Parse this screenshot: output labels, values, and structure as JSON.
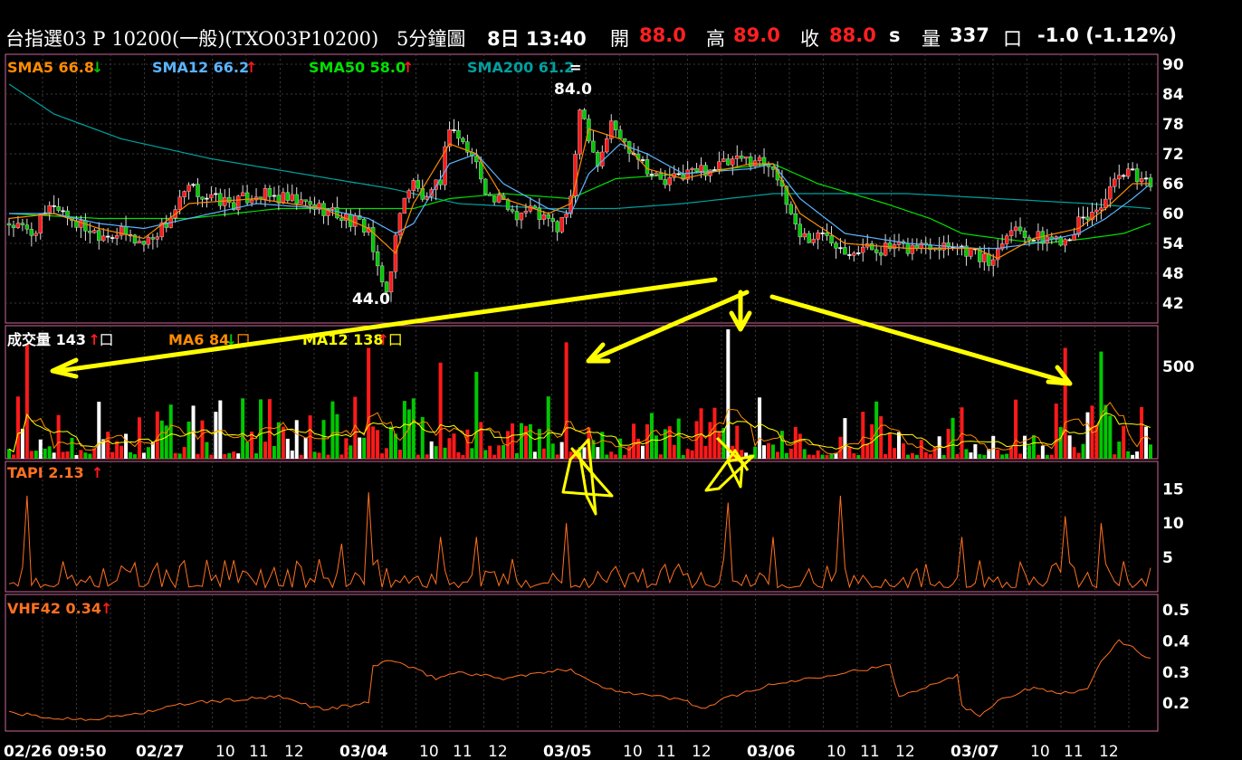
{
  "header": {
    "symbol": "台指選03 P 10200(一般)(TXO03P10200)",
    "period": "5分鐘圖",
    "datetime": "8日 13:40",
    "open_label": "開",
    "open": "88.0",
    "high_label": "高",
    "high": "89.0",
    "close_label": "收",
    "close": "88.0",
    "close_flag": "s",
    "volume_label": "量",
    "volume": "337",
    "volume_unit": "口",
    "change": "-1.0 (-1.12%)"
  },
  "colors": {
    "up": "#ff1a1a",
    "down": "#00c800",
    "flat": "#ffffff",
    "sma5": "#ff8c00",
    "sma12": "#5ab4ff",
    "sma50": "#00e000",
    "sma200": "#00a0a0",
    "grid": "#3a3a3a",
    "frame": "#cc6699",
    "annotation": "#ffff00",
    "indicator": "#ff7020"
  },
  "icons": {
    "up": "arrow-up-icon",
    "down": "arrow-down-icon",
    "flat": "equal-icon"
  },
  "chart_data": [
    {
      "type": "candlestick",
      "title": "",
      "series": [
        {
          "name": "SMA5",
          "value": "66.8",
          "dir": "down"
        },
        {
          "name": "SMA12",
          "value": "66.2",
          "dir": "up"
        },
        {
          "name": "SMA50",
          "value": "58.0",
          "dir": "up"
        },
        {
          "name": "SMA200",
          "value": "61.2",
          "dir": "flat"
        }
      ],
      "y_ticks": [
        "90",
        "84",
        "78",
        "72",
        "66",
        "60",
        "54",
        "48",
        "42"
      ],
      "ylim": [
        38,
        92
      ],
      "annotations": {
        "max": "84.0",
        "min": "44.0"
      },
      "price_path": [
        [
          0,
          58
        ],
        [
          5,
          56
        ],
        [
          10,
          62
        ],
        [
          15,
          58
        ],
        [
          20,
          56
        ],
        [
          25,
          56
        ],
        [
          30,
          54
        ],
        [
          35,
          58
        ],
        [
          40,
          65
        ],
        [
          45,
          63
        ],
        [
          50,
          62
        ],
        [
          55,
          64
        ],
        [
          60,
          63
        ],
        [
          65,
          62
        ],
        [
          70,
          61
        ],
        [
          75,
          59
        ],
        [
          80,
          57
        ],
        [
          82,
          48
        ],
        [
          84,
          44
        ],
        [
          86,
          55
        ],
        [
          88,
          64
        ],
        [
          90,
          66
        ],
        [
          93,
          62
        ],
        [
          96,
          67
        ],
        [
          98,
          78
        ],
        [
          101,
          74
        ],
        [
          104,
          70
        ],
        [
          107,
          63
        ],
        [
          110,
          62
        ],
        [
          113,
          60
        ],
        [
          116,
          61
        ],
        [
          119,
          59
        ],
        [
          122,
          57
        ],
        [
          125,
          62
        ],
        [
          127,
          82
        ],
        [
          129,
          76
        ],
        [
          131,
          70
        ],
        [
          134,
          78
        ],
        [
          137,
          74
        ],
        [
          140,
          72
        ],
        [
          143,
          68
        ],
        [
          146,
          66
        ],
        [
          150,
          68
        ],
        [
          155,
          69
        ],
        [
          160,
          70
        ],
        [
          165,
          71
        ],
        [
          170,
          70
        ],
        [
          172,
          64
        ],
        [
          174,
          60
        ],
        [
          176,
          56
        ],
        [
          178,
          55
        ],
        [
          182,
          56
        ],
        [
          186,
          53
        ],
        [
          190,
          53
        ],
        [
          195,
          53
        ],
        [
          200,
          53
        ],
        [
          205,
          54
        ],
        [
          210,
          54
        ],
        [
          215,
          52
        ],
        [
          218,
          50
        ],
        [
          220,
          53
        ],
        [
          222,
          57
        ],
        [
          225,
          57
        ],
        [
          228,
          55
        ],
        [
          232,
          55
        ],
        [
          235,
          55
        ],
        [
          238,
          58
        ],
        [
          241,
          60
        ],
        [
          244,
          63
        ],
        [
          247,
          67
        ],
        [
          250,
          68
        ],
        [
          254,
          66
        ]
      ],
      "sma5_path": [
        [
          0,
          59
        ],
        [
          10,
          60
        ],
        [
          20,
          57
        ],
        [
          30,
          55
        ],
        [
          40,
          62
        ],
        [
          55,
          63
        ],
        [
          70,
          61
        ],
        [
          80,
          57
        ],
        [
          86,
          52
        ],
        [
          90,
          62
        ],
        [
          98,
          74
        ],
        [
          104,
          72
        ],
        [
          110,
          63
        ],
        [
          120,
          60
        ],
        [
          125,
          62
        ],
        [
          129,
          77
        ],
        [
          136,
          75
        ],
        [
          142,
          69
        ],
        [
          150,
          67
        ],
        [
          165,
          70
        ],
        [
          170,
          70
        ],
        [
          176,
          60
        ],
        [
          186,
          54
        ],
        [
          200,
          53
        ],
        [
          215,
          53
        ],
        [
          220,
          51
        ],
        [
          228,
          55
        ],
        [
          238,
          57
        ],
        [
          244,
          61
        ],
        [
          250,
          66
        ],
        [
          254,
          66
        ]
      ],
      "sma12_path": [
        [
          0,
          60
        ],
        [
          10,
          60
        ],
        [
          20,
          58
        ],
        [
          30,
          57
        ],
        [
          40,
          59
        ],
        [
          55,
          62
        ],
        [
          70,
          61
        ],
        [
          80,
          59
        ],
        [
          86,
          56
        ],
        [
          90,
          58
        ],
        [
          98,
          70
        ],
        [
          104,
          72
        ],
        [
          110,
          66
        ],
        [
          120,
          61
        ],
        [
          125,
          60
        ],
        [
          129,
          68
        ],
        [
          136,
          74
        ],
        [
          142,
          72
        ],
        [
          150,
          68
        ],
        [
          165,
          69
        ],
        [
          170,
          70
        ],
        [
          176,
          63
        ],
        [
          186,
          56
        ],
        [
          200,
          54
        ],
        [
          215,
          53
        ],
        [
          220,
          53
        ],
        [
          228,
          54
        ],
        [
          238,
          56
        ],
        [
          244,
          59
        ],
        [
          250,
          63
        ],
        [
          254,
          66
        ]
      ],
      "sma50_path": [
        [
          0,
          60
        ],
        [
          20,
          59
        ],
        [
          40,
          59
        ],
        [
          60,
          61
        ],
        [
          80,
          61
        ],
        [
          90,
          61
        ],
        [
          98,
          63
        ],
        [
          110,
          64
        ],
        [
          125,
          63
        ],
        [
          135,
          67
        ],
        [
          150,
          68
        ],
        [
          170,
          70
        ],
        [
          180,
          66
        ],
        [
          195,
          62
        ],
        [
          205,
          59
        ],
        [
          212,
          56
        ],
        [
          220,
          55
        ],
        [
          230,
          54
        ],
        [
          240,
          55
        ],
        [
          248,
          56
        ],
        [
          254,
          58
        ]
      ],
      "sma200_path": [
        [
          0,
          86
        ],
        [
          10,
          80
        ],
        [
          25,
          75
        ],
        [
          45,
          71
        ],
        [
          65,
          68
        ],
        [
          85,
          65
        ],
        [
          100,
          62
        ],
        [
          120,
          61
        ],
        [
          135,
          61
        ],
        [
          150,
          62
        ],
        [
          170,
          64
        ],
        [
          185,
          64
        ],
        [
          200,
          64
        ],
        [
          220,
          63
        ],
        [
          240,
          62
        ],
        [
          254,
          61
        ]
      ]
    },
    {
      "type": "bar",
      "title": "成交量",
      "series": [
        {
          "name": "成交量",
          "value": "143",
          "dir": "up",
          "unit": "口"
        },
        {
          "name": "MA6",
          "value": "84",
          "dir": "down",
          "unit": "口"
        },
        {
          "name": "MA12",
          "value": "138",
          "dir": "up",
          "unit": "口"
        }
      ],
      "y_ticks": [
        "500"
      ],
      "ylim": [
        0,
        720
      ],
      "spikes": [
        [
          4,
          620
        ],
        [
          80,
          600
        ],
        [
          96,
          520
        ],
        [
          104,
          470
        ],
        [
          124,
          630
        ],
        [
          160,
          740
        ],
        [
          235,
          600
        ],
        [
          243,
          580
        ]
      ]
    },
    {
      "type": "line",
      "title": "TAPI",
      "series": [
        {
          "name": "TAPI",
          "value": "2.13",
          "dir": "up"
        }
      ],
      "y_ticks": [
        "15",
        "10",
        "5"
      ],
      "ylim": [
        0,
        19
      ],
      "spikes": [
        [
          4,
          14
        ],
        [
          74,
          7
        ],
        [
          80,
          14.5
        ],
        [
          96,
          8
        ],
        [
          104,
          8
        ],
        [
          124,
          10
        ],
        [
          160,
          13
        ],
        [
          170,
          8
        ],
        [
          185,
          14
        ],
        [
          212,
          8
        ],
        [
          235,
          11
        ],
        [
          243,
          10
        ]
      ]
    },
    {
      "type": "line",
      "title": "VHF42",
      "series": [
        {
          "name": "VHF42",
          "value": "0.34",
          "dir": "up"
        }
      ],
      "y_ticks": [
        "0.5",
        "0.4",
        "0.3",
        "0.2"
      ],
      "ylim": [
        0.11,
        0.55
      ],
      "path": [
        [
          0,
          0.17
        ],
        [
          5,
          0.16
        ],
        [
          10,
          0.15
        ],
        [
          20,
          0.15
        ],
        [
          30,
          0.17
        ],
        [
          40,
          0.2
        ],
        [
          50,
          0.21
        ],
        [
          60,
          0.22
        ],
        [
          70,
          0.18
        ],
        [
          80,
          0.2
        ],
        [
          81,
          0.32
        ],
        [
          85,
          0.34
        ],
        [
          90,
          0.31
        ],
        [
          95,
          0.28
        ],
        [
          100,
          0.3
        ],
        [
          110,
          0.28
        ],
        [
          120,
          0.3
        ],
        [
          125,
          0.31
        ],
        [
          132,
          0.25
        ],
        [
          140,
          0.23
        ],
        [
          150,
          0.21
        ],
        [
          155,
          0.18
        ],
        [
          160,
          0.22
        ],
        [
          170,
          0.26
        ],
        [
          178,
          0.28
        ],
        [
          186,
          0.3
        ],
        [
          196,
          0.32
        ],
        [
          198,
          0.22
        ],
        [
          205,
          0.26
        ],
        [
          211,
          0.29
        ],
        [
          212,
          0.19
        ],
        [
          216,
          0.16
        ],
        [
          220,
          0.21
        ],
        [
          228,
          0.25
        ],
        [
          236,
          0.23
        ],
        [
          240,
          0.25
        ],
        [
          243,
          0.33
        ],
        [
          247,
          0.4
        ],
        [
          250,
          0.38
        ],
        [
          254,
          0.34
        ]
      ]
    }
  ],
  "x_axis": [
    "02/26 09:50",
    "02/27",
    "10",
    "11",
    "12",
    "03/04",
    "10",
    "11",
    "12",
    "03/05",
    "10",
    "11",
    "12",
    "03/06",
    "10",
    "11",
    "12",
    "03/07",
    "10",
    "11",
    "12"
  ]
}
